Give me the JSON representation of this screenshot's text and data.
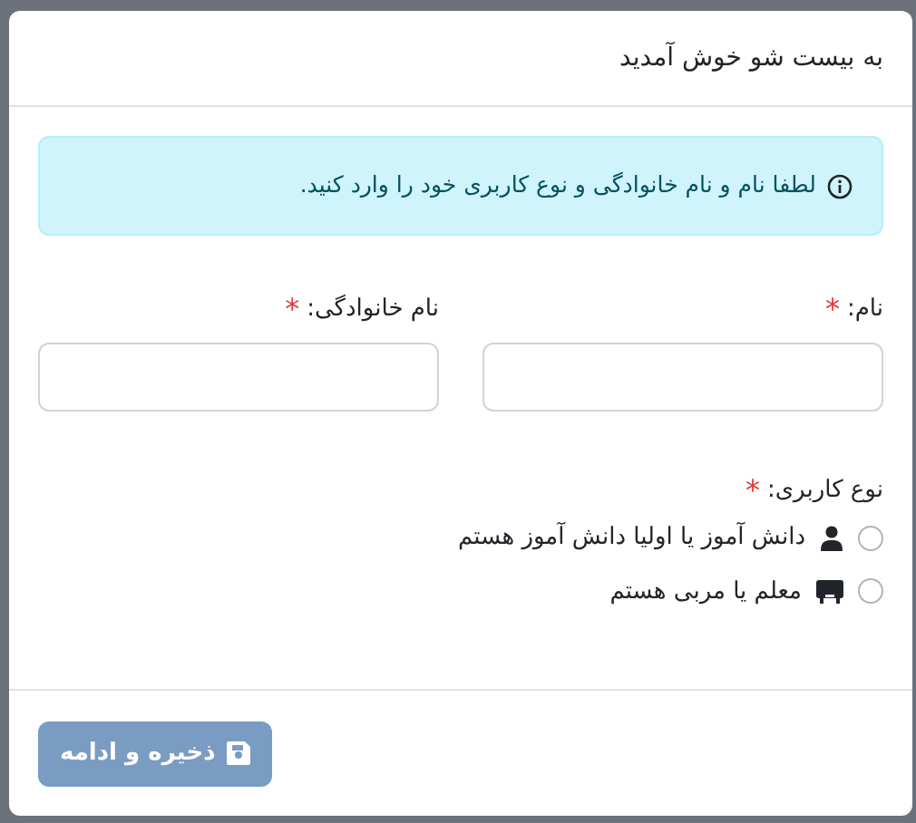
{
  "dialog": {
    "title": "به بیست شو خوش آمدید"
  },
  "alert": {
    "text": "لطفا نام و نام خانوادگی و نوع کاربری خود را وارد کنید."
  },
  "fields": [
    {
      "label": "نام:",
      "required_mark": "*"
    },
    {
      "label": "نام خانوادگی:",
      "required_mark": "*"
    }
  ],
  "user_type": {
    "label": "نوع کاربری:",
    "required_mark": "*",
    "options": [
      {
        "kind": "student",
        "label": "دانش آموز یا اولیا دانش آموز هستم",
        "selected": false
      },
      {
        "kind": "teacher",
        "label": "معلم یا مربی هستم",
        "selected": false
      }
    ]
  },
  "footer": {
    "button": {
      "label": "ذخیره و ادامه",
      "disabled": true
    }
  }
}
